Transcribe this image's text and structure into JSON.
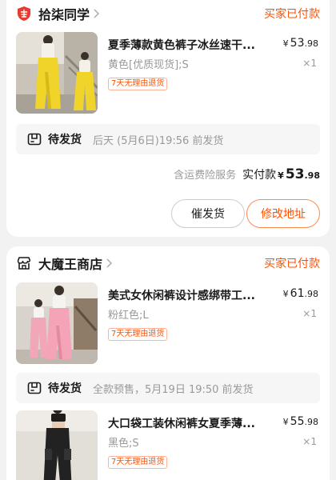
{
  "orders": [
    {
      "shop_name": "拾柒同学",
      "status": "买家已付款",
      "item": {
        "title": "夏季薄款黄色裤子冰丝速干...",
        "price_currency": "¥",
        "price_int": "53",
        "price_dec": ".98",
        "sku": "黄色[优质现货];S",
        "quantity": "×1",
        "badge": "7天无理由退货"
      },
      "shipping": {
        "label": "待发货",
        "desc": "后天 (5月6日)19:56 前发货"
      },
      "summary": {
        "insurance": "含运费险服务",
        "paid_label": "实付款",
        "paid_currency": "¥",
        "paid_int": "53",
        "paid_dec": ".98"
      },
      "buttons": {
        "urge": "催发货",
        "change_address": "修改地址"
      }
    },
    {
      "shop_name": "大魔王商店",
      "status": "买家已付款",
      "items": [
        {
          "title": "美式女休闲裤设计感绑带工...",
          "price_currency": "¥",
          "price_int": "61",
          "price_dec": ".98",
          "sku": "粉红色;L",
          "quantity": "×1",
          "badge": "7天无理由退货"
        },
        {
          "title": "大口袋工装休闲裤女夏季薄...",
          "price_currency": "¥",
          "price_int": "55",
          "price_dec": ".98",
          "sku": "黑色;S",
          "quantity": "×1",
          "badge": "7天无理由退货"
        }
      ],
      "shipping": {
        "label": "待发货",
        "desc": "全款预售，5月19日 19:50 前发货"
      }
    }
  ],
  "colors": {
    "accent": "#ff5000",
    "muted": "#999999",
    "logo_red": "#e83a2f"
  },
  "icons": [
    "shop-logo-icon",
    "store-icon",
    "chevron-right-icon",
    "shipping-box-icon"
  ]
}
